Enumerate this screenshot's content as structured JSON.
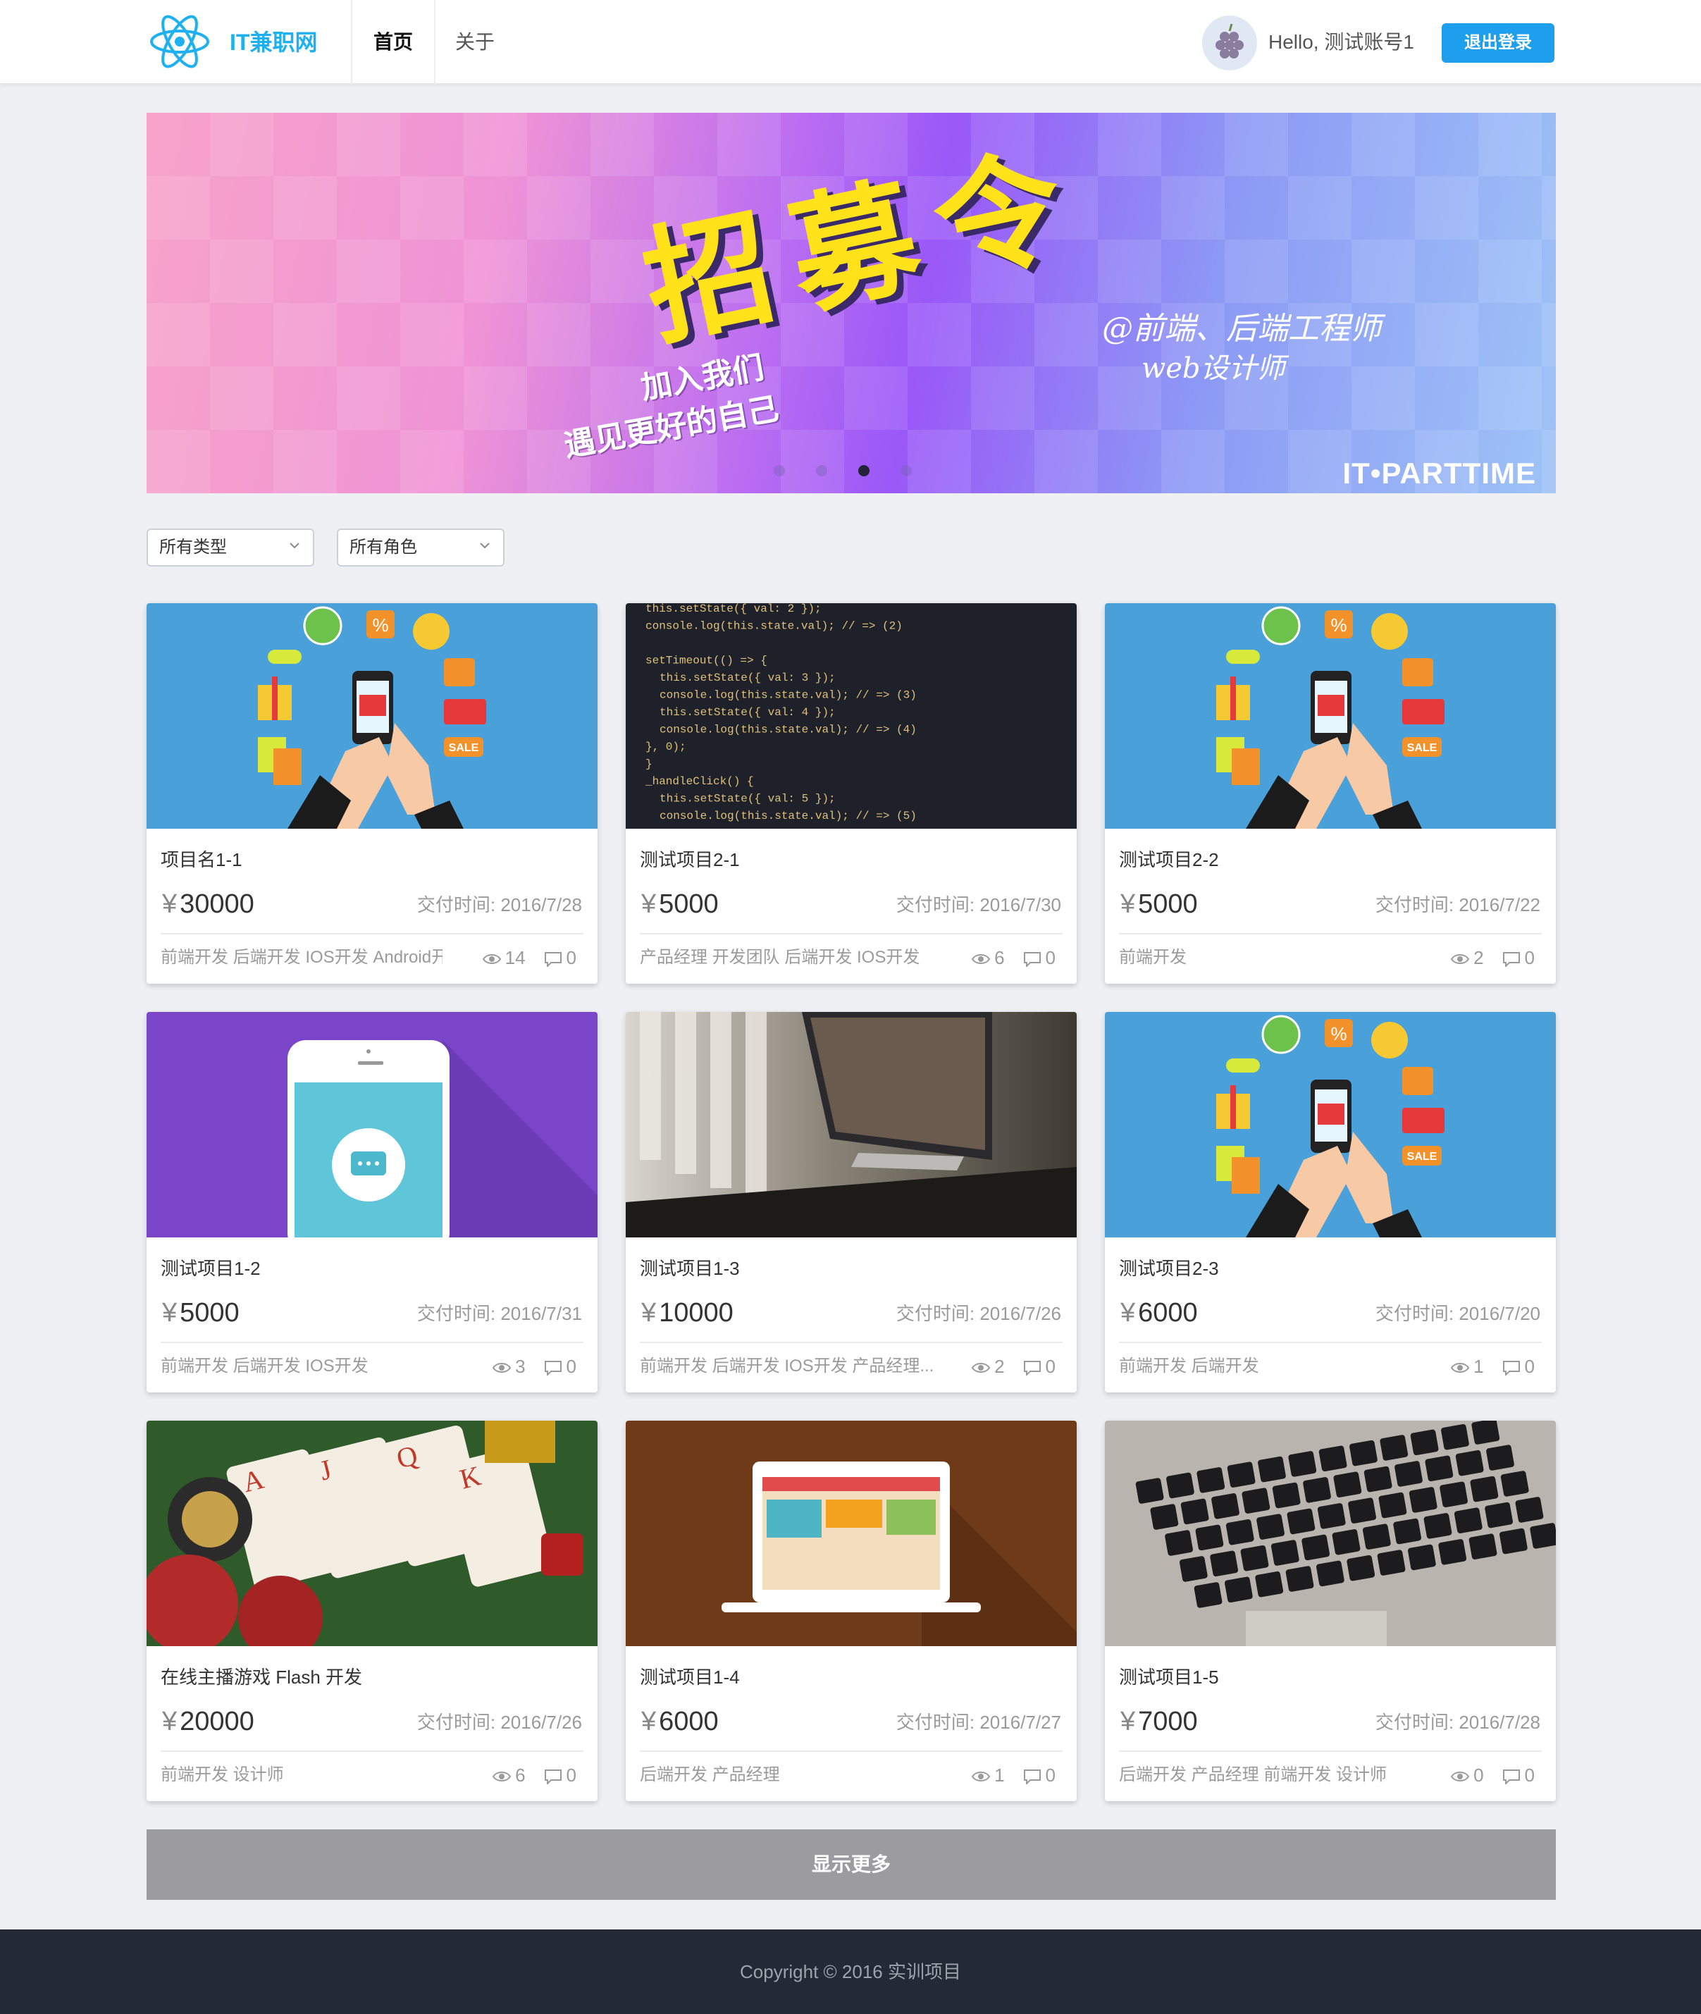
{
  "header": {
    "brand": "IT兼职网",
    "nav": [
      "首页",
      "关于"
    ],
    "greeting": "Hello, 测试账号1",
    "logout_label": "退出登录"
  },
  "banner": {
    "title": "招募令",
    "subtitle_1": "加入我们",
    "subtitle_2": "遇见更好的自己",
    "right_1": "@前端、后端工程师",
    "right_2": "web设计师",
    "brand": "IT•PARTTIME",
    "slide_count": 4,
    "active_slide": 3
  },
  "filters": {
    "type_label": "所有类型",
    "role_label": "所有角色"
  },
  "projects": [
    {
      "title": "项目名1-1",
      "price": "30000",
      "due": "交付时间: 2016/7/28",
      "tags": "前端开发 后端开发 IOS开发 Android开..",
      "views": "14",
      "comments": "0",
      "thumb": "shopping-illustration"
    },
    {
      "title": "测试项目2-1",
      "price": "5000",
      "due": "交付时间: 2016/7/30",
      "tags": "产品经理 开发团队 后端开发 IOS开发",
      "views": "6",
      "comments": "0",
      "thumb": "code-screenshot"
    },
    {
      "title": "测试项目2-2",
      "price": "5000",
      "due": "交付时间: 2016/7/22",
      "tags": "前端开发",
      "views": "2",
      "comments": "0",
      "thumb": "shopping-illustration"
    },
    {
      "title": "测试项目1-2",
      "price": "5000",
      "due": "交付时间: 2016/7/31",
      "tags": "前端开发 后端开发 IOS开发",
      "views": "3",
      "comments": "0",
      "thumb": "phone-chat-illustration"
    },
    {
      "title": "测试项目1-3",
      "price": "10000",
      "due": "交付时间: 2016/7/26",
      "tags": "前端开发 后端开发 IOS开发 产品经理...",
      "views": "2",
      "comments": "0",
      "thumb": "desk-computer-photo"
    },
    {
      "title": "测试项目2-3",
      "price": "6000",
      "due": "交付时间: 2016/7/20",
      "tags": "前端开发 后端开发",
      "views": "1",
      "comments": "0",
      "thumb": "shopping-illustration"
    },
    {
      "title": "在线主播游戏 Flash 开发",
      "price": "20000",
      "due": "交付时间: 2016/7/26",
      "tags": "前端开发 设计师",
      "views": "6",
      "comments": "0",
      "thumb": "casino-photo"
    },
    {
      "title": "测试项目1-4",
      "price": "6000",
      "due": "交付时间: 2016/7/27",
      "tags": "后端开发 产品经理",
      "views": "1",
      "comments": "0",
      "thumb": "laptop-illustration"
    },
    {
      "title": "测试项目1-5",
      "price": "7000",
      "due": "交付时间: 2016/7/28",
      "tags": "后端开发 产品经理 前端开发 设计师",
      "views": "0",
      "comments": "0",
      "thumb": "keyboard-photo"
    }
  ],
  "currency_symbol": "¥",
  "code_lines": [
    "this.setState({ val: 2 });",
    "console.log(this.state.val); // => (2)",
    "",
    "setTimeout(() => {",
    "  this.setState({ val: 3 });",
    "  console.log(this.state.val); // => (3)",
    "  this.setState({ val: 4 });",
    "  console.log(this.state.val); // => (4)",
    "}, 0);",
    "}",
    "_handleClick() {",
    "  this.setState({ val: 5 });",
    "  console.log(this.state.val); // => (5)"
  ],
  "more_label": "显示更多",
  "footer": "Copyright © 2016 实训项目",
  "colors": {
    "accent": "#1e9fee",
    "brand": "#1fb0f0",
    "footer_bg": "#222a36",
    "more_bg": "#9c9ca0"
  }
}
